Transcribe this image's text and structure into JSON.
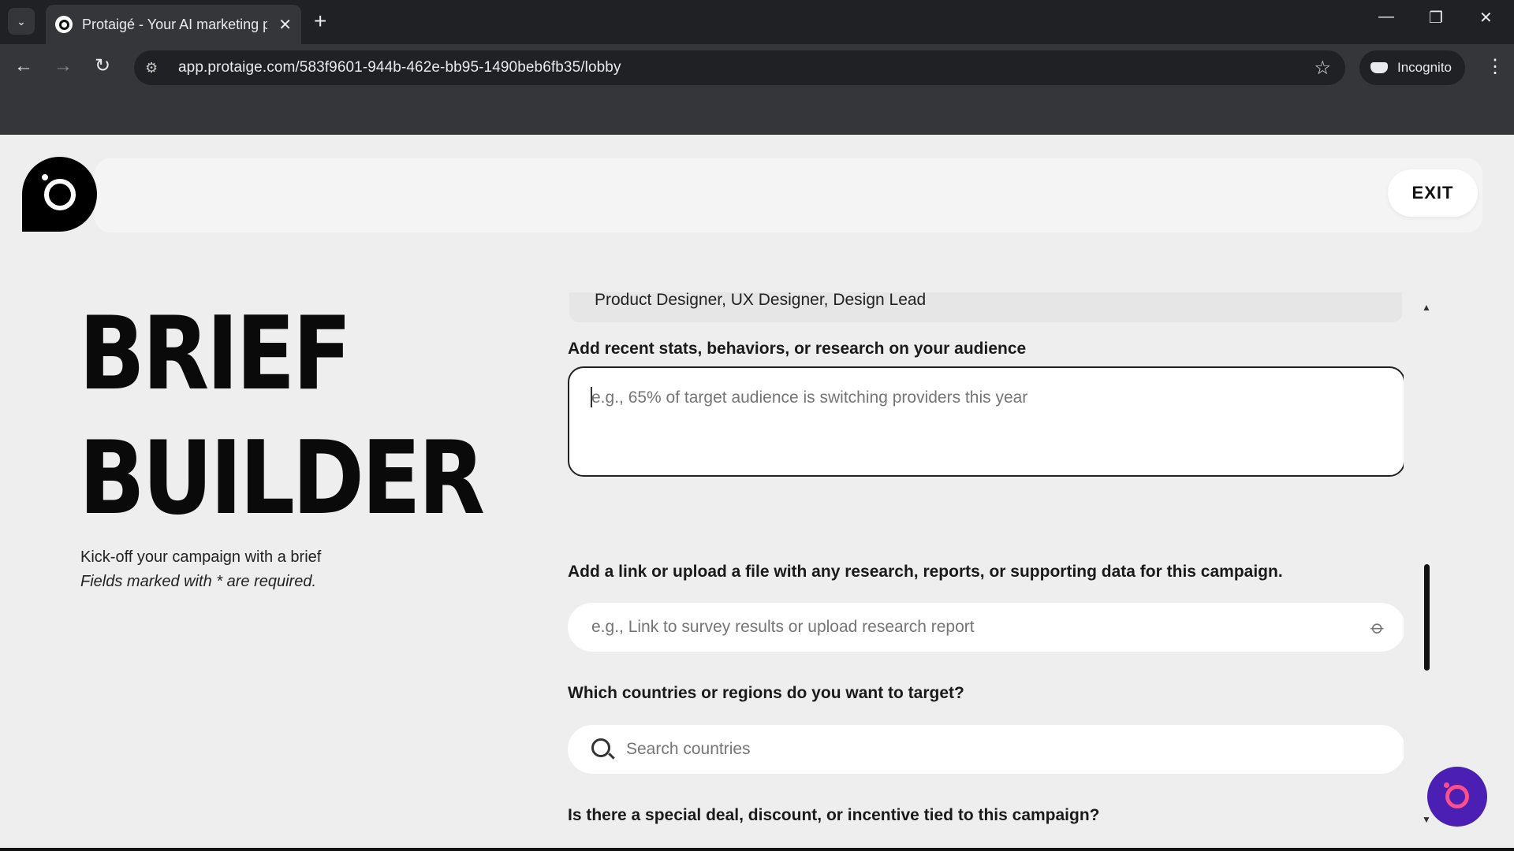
{
  "browser": {
    "tab_title": "Protaigé - Your AI marketing pr",
    "tab_close": "✕",
    "new_tab": "+",
    "url": "app.protaige.com/583f9601-944b-462e-bb95-1490beb6fb35/lobby",
    "incognito_label": "Incognito",
    "window_controls": {
      "minimize": "—",
      "restore": "❐",
      "close": "✕"
    },
    "nav": {
      "back": "←",
      "forward": "→",
      "reload": "↻",
      "star": "☆",
      "menu": "⋮",
      "tab_list": "⌄",
      "site_info": "⚙"
    }
  },
  "app": {
    "exit_label": "EXIT",
    "hero_title": "BRIEF\nBUILDER",
    "subtitle": "Kick-off your campaign with a brief",
    "required_note": "Fields marked with * are required.",
    "form": {
      "audience_roles_value": "Product Designer, UX Designer, Design Lead",
      "research_label": "Add recent stats, behaviors, or research on your audience",
      "research_placeholder": "e.g., 65% of target audience is switching providers this year",
      "link_label": "Add a link or upload a file with any research, reports, or supporting data for this campaign.",
      "link_placeholder": "e.g., Link to survey results or upload research report",
      "regions_label": "Which countries or regions do you want to target?",
      "regions_placeholder": "Search countries",
      "deal_label": "Is there a special deal, discount, or incentive tied to this campaign?"
    },
    "icons": {
      "attach": "⌀",
      "scroll_up": "▲",
      "scroll_down": "▼"
    }
  },
  "colors": {
    "chrome_dark": "#202124",
    "chrome_mid": "#35363a",
    "page_bg": "#eeeeee",
    "fab_bg": "#4b1fb3",
    "fab_accent": "#ff4f8a"
  }
}
